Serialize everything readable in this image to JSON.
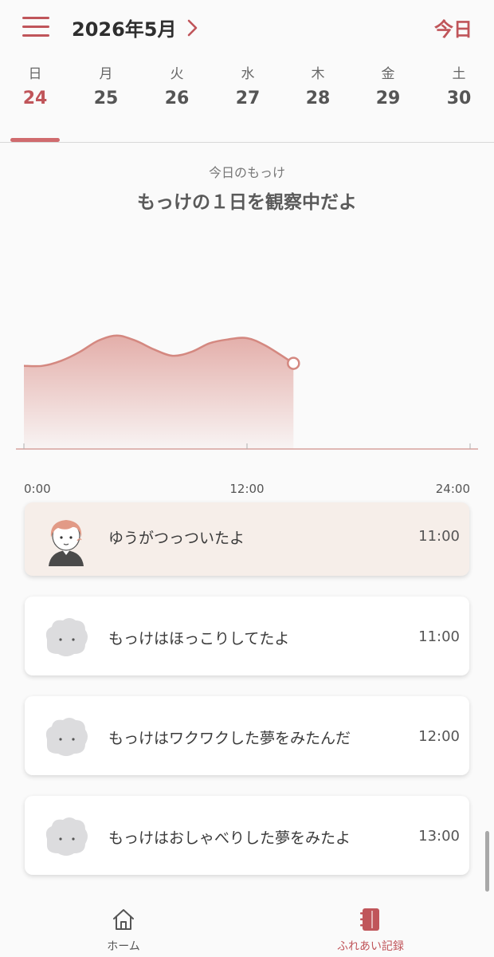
{
  "header": {
    "menu_icon": "hamburger-menu-icon",
    "month": "2026年5月",
    "next_icon": "chevron-right-icon",
    "today": "今日"
  },
  "week": {
    "days": [
      {
        "weekday": "日",
        "date": "24",
        "selected": true
      },
      {
        "weekday": "月",
        "date": "25",
        "selected": false
      },
      {
        "weekday": "火",
        "date": "26",
        "selected": false
      },
      {
        "weekday": "水",
        "date": "27",
        "selected": false
      },
      {
        "weekday": "木",
        "date": "28",
        "selected": false
      },
      {
        "weekday": "金",
        "date": "29",
        "selected": false
      },
      {
        "weekday": "土",
        "date": "30",
        "selected": false
      }
    ]
  },
  "summary": {
    "subtitle": "今日のもっけ",
    "title": "もっけの１日を観察中だよ"
  },
  "chart_data": {
    "type": "area",
    "x_ticks": [
      "0:00",
      "12:00",
      "24:00"
    ],
    "xlim": [
      0,
      24
    ],
    "x": [
      0,
      1,
      2,
      3,
      4,
      5,
      6,
      7,
      8,
      9,
      10,
      11,
      12,
      13,
      14.5
    ],
    "y": [
      0.66,
      0.66,
      0.7,
      0.77,
      0.86,
      0.9,
      0.86,
      0.79,
      0.74,
      0.77,
      0.84,
      0.87,
      0.88,
      0.82,
      0.68
    ],
    "current_point_x": 14.5,
    "line_color": "#d48880",
    "fill_color": "#e2aaa5"
  },
  "feed": [
    {
      "message": "ゆうがつっついたよ",
      "time": "11:00",
      "avatar": "boy-avatar-icon",
      "highlight": true
    },
    {
      "message": "もっけはほっこりしてたよ",
      "time": "11:00",
      "avatar": "mokke-fluff-icon",
      "highlight": false
    },
    {
      "message": "もっけはワクワクした夢をみたんだ",
      "time": "12:00",
      "avatar": "mokke-fluff-icon",
      "highlight": false
    },
    {
      "message": "もっけはおしゃべりした夢をみたよ",
      "time": "13:00",
      "avatar": "mokke-fluff-icon",
      "highlight": false
    }
  ],
  "nav": {
    "home": {
      "label": "ホーム",
      "icon": "home-icon"
    },
    "records": {
      "label": "ふれあい記録",
      "icon": "notebook-icon"
    }
  },
  "colors": {
    "accent": "#c0555a",
    "card_highlight": "#f6eee9",
    "background": "#fafafa"
  }
}
